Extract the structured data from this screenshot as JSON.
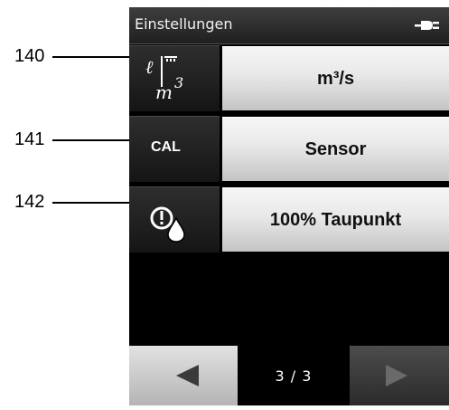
{
  "window": {
    "title": "Einstellungen",
    "power_icon": "plug-icon"
  },
  "callouts": [
    {
      "label": "140"
    },
    {
      "label": "141"
    },
    {
      "label": "142"
    }
  ],
  "rows": [
    {
      "icon": "flow-unit-icon",
      "value": "m³/s"
    },
    {
      "icon_text": "CAL",
      "value": "Sensor"
    },
    {
      "icon": "dewpoint-alarm-icon",
      "value": "100% Taupunkt"
    }
  ],
  "pager": {
    "indicator": "3 / 3",
    "prev_icon": "arrow-left-icon",
    "next_icon": "arrow-right-icon"
  }
}
